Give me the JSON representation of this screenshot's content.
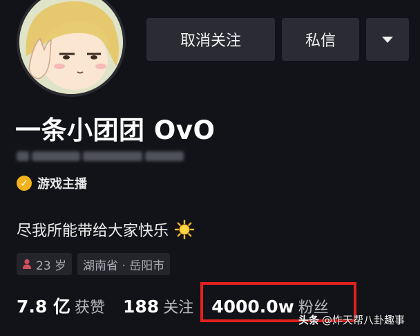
{
  "profile": {
    "name": "一条小团团 OvO",
    "verified_label": "游戏主播",
    "bio": "尽我所能带给大家快乐",
    "bio_emoji": "☀"
  },
  "actions": {
    "unfollow_label": "取消关注",
    "message_label": "私信"
  },
  "tags": [
    {
      "icon": "female-icon",
      "label": "23 岁"
    },
    {
      "label": "湖南省 · 岳阳市"
    }
  ],
  "stats": {
    "likes_value": "7.8 亿",
    "likes_label": "获赞",
    "following_value": "188",
    "following_label": "关注",
    "followers_value": "4000.0w",
    "followers_label": "粉丝"
  },
  "annotation": {
    "highlight_color": "#e0211d"
  },
  "colors": {
    "background": "#121318",
    "button": "#2b2c33",
    "badge": "#f3b21a"
  },
  "watermark": {
    "logo": "头条",
    "handle": "@炸天帮八卦趣事"
  }
}
